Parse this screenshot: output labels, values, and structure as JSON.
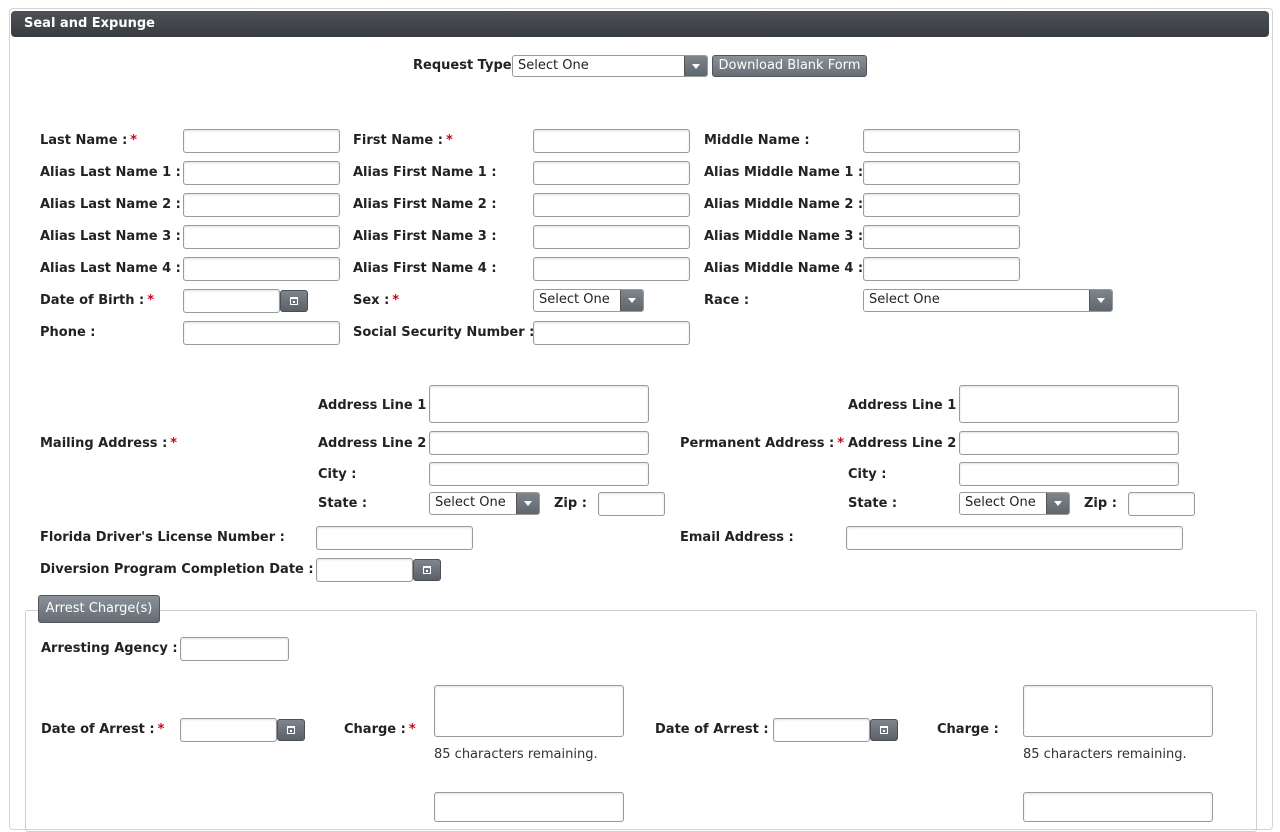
{
  "panel": {
    "title": "Seal and Expunge"
  },
  "request": {
    "label": "Request Type:",
    "value": "Select One",
    "download_label": "Download Blank Form"
  },
  "names": {
    "last": "Last Name :",
    "first": "First Name :",
    "middle": "Middle Name :",
    "alias_last_1": "Alias Last Name 1 :",
    "alias_first_1": "Alias First Name 1 :",
    "alias_middle_1": "Alias Middle Name 1 :",
    "alias_last_2": "Alias Last Name 2 :",
    "alias_first_2": "Alias First Name 2 :",
    "alias_middle_2": "Alias Middle Name 2 :",
    "alias_last_3": "Alias Last Name 3 :",
    "alias_first_3": "Alias First Name 3 :",
    "alias_middle_3": "Alias Middle Name 3 :",
    "alias_last_4": "Alias Last Name 4 :",
    "alias_first_4": "Alias First Name 4 :",
    "alias_middle_4": "Alias Middle Name 4 :"
  },
  "personal": {
    "dob": "Date of Birth :",
    "sex": "Sex :",
    "sex_value": "Select One",
    "race": "Race :",
    "race_value": "Select One",
    "phone": "Phone :",
    "ssn": "Social Security Number :"
  },
  "mailing": {
    "label": "Mailing Address :",
    "line1": "Address Line 1 :",
    "line2": "Address Line 2 :",
    "city": "City :",
    "state": "State :",
    "state_value": "Select One",
    "zip": "Zip :"
  },
  "permanent": {
    "label": "Permanent Address :",
    "line1": "Address Line 1 :",
    "line2": "Address Line 2 :",
    "city": "City :",
    "state": "State :",
    "state_value": "Select One",
    "zip": "Zip :"
  },
  "license": {
    "label": "Florida Driver's License Number :"
  },
  "email": {
    "label": "Email Address :"
  },
  "diversion": {
    "label": "Diversion Program Completion Date :"
  },
  "arrest": {
    "legend": "Arrest Charge(s)",
    "agency": "Arresting Agency :",
    "date_of_arrest": "Date of Arrest :",
    "charge": "Charge :",
    "remaining": "85 characters remaining."
  },
  "colors": {
    "required": "#d0021b",
    "titlebar": "#3f4347",
    "button": "#737a81"
  }
}
